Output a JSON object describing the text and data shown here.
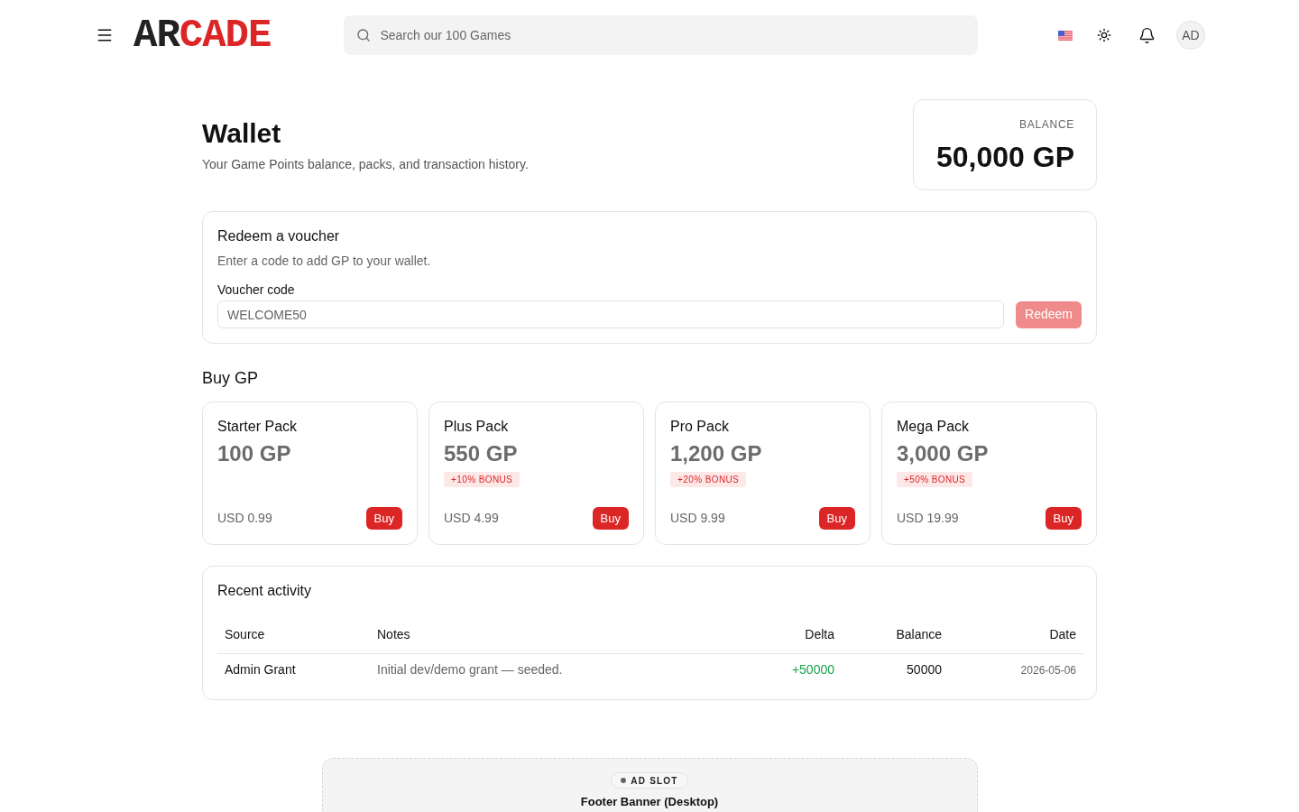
{
  "header": {
    "logo": {
      "dark": "AR",
      "accent": "CADE"
    },
    "search": {
      "placeholder": "Search our 100 Games"
    },
    "avatar": "AD"
  },
  "page": {
    "title": "Wallet",
    "subtitle": "Your Game Points balance, packs, and transaction history."
  },
  "balance": {
    "label": "BALANCE",
    "value": "50,000 GP"
  },
  "voucher": {
    "title": "Redeem a voucher",
    "description": "Enter a code to add GP to your wallet.",
    "field_label": "Voucher code",
    "placeholder": "WELCOME50",
    "redeem_button": {
      "label": "Redeem",
      "disabled": true
    }
  },
  "buy_gp": {
    "heading": "Buy GP",
    "packs": [
      {
        "name": "Starter Pack",
        "amount": "100 GP",
        "price": "USD 0.99",
        "button": "Buy"
      },
      {
        "name": "Plus Pack",
        "amount": "550 GP",
        "bonus": "+10% BONUS",
        "price": "USD 4.99",
        "button": "Buy"
      },
      {
        "name": "Pro Pack",
        "amount": "1,200 GP",
        "bonus": "+20% BONUS",
        "price": "USD 9.99",
        "button": "Buy"
      },
      {
        "name": "Mega Pack",
        "amount": "3,000 GP",
        "bonus": "+50% BONUS",
        "price": "USD 19.99",
        "button": "Buy"
      }
    ]
  },
  "activity": {
    "title": "Recent activity",
    "columns": [
      "Source",
      "Notes",
      "Delta",
      "Balance",
      "Date"
    ],
    "rows": [
      {
        "kind": "credit",
        "source": "Admin Grant",
        "notes": "Initial dev/demo grant — seeded.",
        "delta": "+50000",
        "balance": "50000",
        "date": "2026-05-06"
      }
    ]
  },
  "ad_slot": {
    "badge": "AD SLOT",
    "title": "Footer Banner (Desktop)"
  }
}
